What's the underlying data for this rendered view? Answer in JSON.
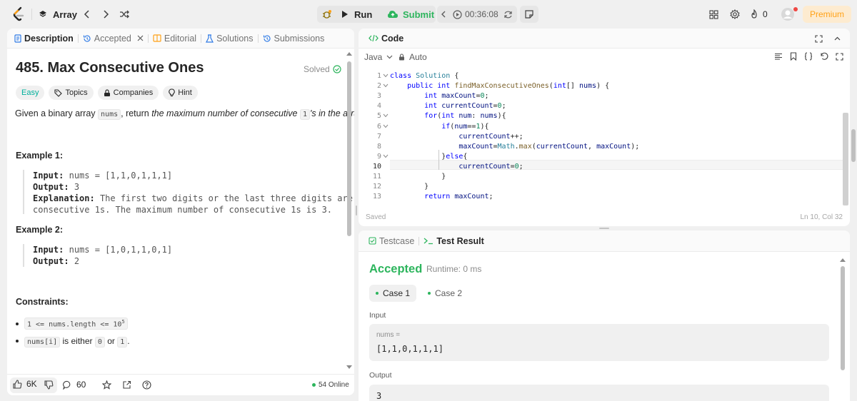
{
  "topbar": {
    "problem_list_label": "Array",
    "run_label": "Run",
    "submit_label": "Submit",
    "timer": "00:36:08",
    "notification_count": "0",
    "premium_label": "Premium"
  },
  "left_tabs": [
    {
      "label": "Description"
    },
    {
      "label": "Accepted"
    },
    {
      "label": "Editorial"
    },
    {
      "label": "Solutions"
    },
    {
      "label": "Submissions"
    }
  ],
  "problem": {
    "title": "485. Max Consecutive Ones",
    "status": "Solved",
    "tags": {
      "difficulty": "Easy",
      "topics": "Topics",
      "companies": "Companies",
      "hint": "Hint"
    },
    "desc_prefix": "Given a binary array ",
    "desc_code": "nums",
    "desc_mid": ", return ",
    "desc_italic": "the maximum number of consecutive ",
    "desc_code2": "1",
    "desc_suffix": "'s in the array.",
    "example1_title": "Example 1:",
    "example1": {
      "input_label": "Input:",
      "input": "nums = [1,1,0,1,1,1]",
      "output_label": "Output:",
      "output": "3",
      "explanation_label": "Explanation:",
      "explanation_1": "The first two digits or the last three digits are",
      "explanation_2": "consecutive 1s. The maximum number of consecutive 1s is 3."
    },
    "example2_title": "Example 2:",
    "example2": {
      "input_label": "Input:",
      "input": "nums = [1,0,1,1,0,1]",
      "output_label": "Output:",
      "output": "2"
    },
    "constraints_title": "Constraints:",
    "constraint1_code": "1 <= nums.length <= 10",
    "constraint1_sup": "5",
    "constraint2_code1": "nums[i]",
    "constraint2_text": " is either ",
    "constraint2_code2": "0",
    "constraint2_or": " or ",
    "constraint2_code3": "1",
    "constraint2_end": "."
  },
  "left_footer": {
    "likes": "6K",
    "comments": "60",
    "online": "54 Online"
  },
  "code_panel": {
    "title": "Code",
    "language": "Java",
    "mode": "Auto",
    "saved": "Saved",
    "cursor": "Ln 10, Col 32",
    "lines": [
      {
        "n": "1",
        "text": "class Solution {"
      },
      {
        "n": "2",
        "text": "    public int findMaxConsecutiveOnes(int[] nums) {"
      },
      {
        "n": "3",
        "text": "        int maxCount=0;"
      },
      {
        "n": "4",
        "text": "        int currentCount=0;"
      },
      {
        "n": "5",
        "text": "        for(int num: nums){"
      },
      {
        "n": "6",
        "text": "            if(num==1){"
      },
      {
        "n": "7",
        "text": "                currentCount++;"
      },
      {
        "n": "8",
        "text": "                maxCount=Math.max(currentCount, maxCount);"
      },
      {
        "n": "9",
        "text": "            }else{"
      },
      {
        "n": "10",
        "text": "                currentCount=0;"
      },
      {
        "n": "11",
        "text": "            }"
      },
      {
        "n": "12",
        "text": "        }"
      },
      {
        "n": "13",
        "text": "        return maxCount;"
      }
    ]
  },
  "result_panel": {
    "tab_testcase": "Testcase",
    "tab_result": "Test Result",
    "status": "Accepted",
    "runtime": "Runtime: 0 ms",
    "case1": "Case 1",
    "case2": "Case 2",
    "input_label": "Input",
    "var_label": "nums =",
    "var_value": "[1,1,0,1,1,1]",
    "output_label": "Output",
    "output_value": "3"
  },
  "colors": {
    "accent_green": "#2db55d",
    "premium": "#ffa116",
    "easy": "#00af9b"
  }
}
